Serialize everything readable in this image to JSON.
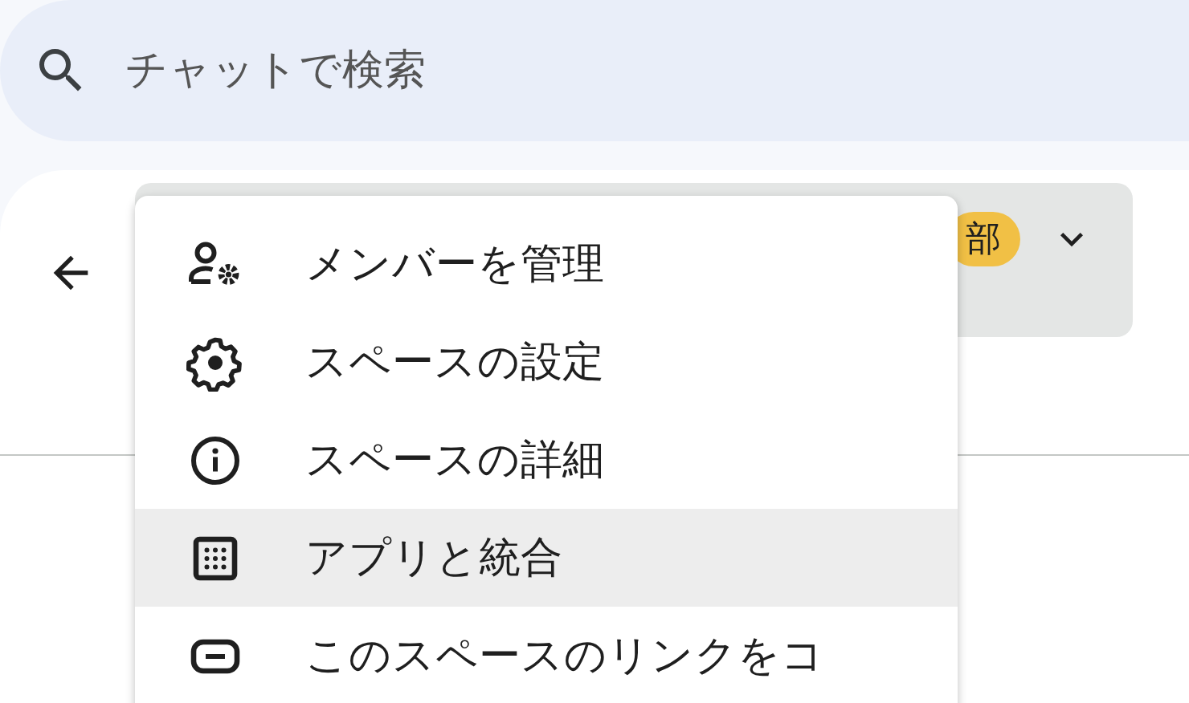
{
  "search": {
    "placeholder": "チャットで検索"
  },
  "header": {
    "badge": "部"
  },
  "menu": [
    {
      "kind": "members",
      "label": "メンバーを管理",
      "highlighted": false
    },
    {
      "kind": "settings",
      "label": "スペースの設定",
      "highlighted": false
    },
    {
      "kind": "info",
      "label": "スペースの詳細",
      "highlighted": false
    },
    {
      "kind": "apps",
      "label": "アプリと統合",
      "highlighted": true
    },
    {
      "kind": "link",
      "label": "このスペースのリンクをコ",
      "highlighted": false
    }
  ]
}
